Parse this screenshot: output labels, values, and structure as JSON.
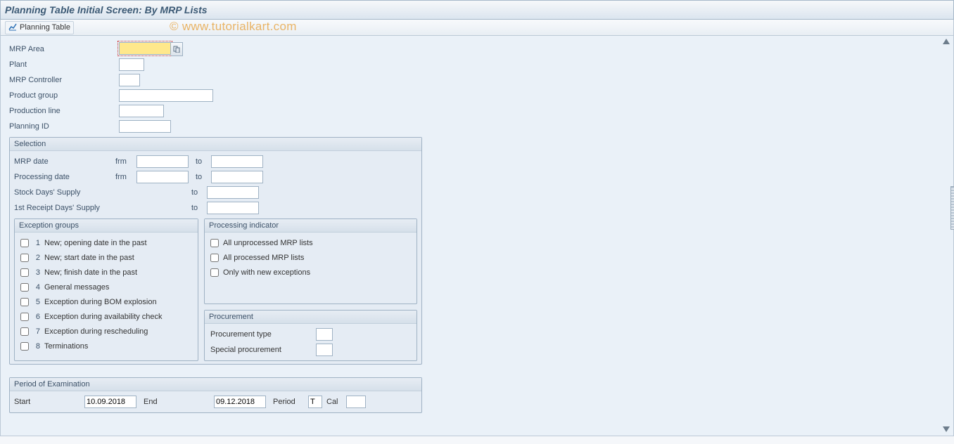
{
  "header": {
    "title": "Planning Table Initial Screen: By MRP Lists"
  },
  "toolbar": {
    "planning_table": "Planning Table"
  },
  "watermark": "© www.tutorialkart.com",
  "fields": {
    "mrp_area_lbl": "MRP Area",
    "plant_lbl": "Plant",
    "mrp_controller_lbl": "MRP Controller",
    "product_group_lbl": "Product group",
    "production_line_lbl": "Production line",
    "planning_id_lbl": "Planning ID"
  },
  "selection": {
    "title": "Selection",
    "mrp_date_lbl": "MRP date",
    "processing_date_lbl": "Processing date",
    "stock_supply_lbl": "Stock Days' Supply",
    "first_receipt_lbl": "1st Receipt Days' Supply",
    "frm": "frm",
    "to": "to"
  },
  "exception_groups": {
    "title": "Exception groups",
    "items": [
      {
        "num": "1",
        "label": "New; opening date in the past"
      },
      {
        "num": "2",
        "label": "New; start date in the past"
      },
      {
        "num": "3",
        "label": "New; finish date in the past"
      },
      {
        "num": "4",
        "label": "General messages"
      },
      {
        "num": "5",
        "label": "Exception during BOM explosion"
      },
      {
        "num": "6",
        "label": "Exception during availability check"
      },
      {
        "num": "7",
        "label": "Exception during rescheduling"
      },
      {
        "num": "8",
        "label": "Terminations"
      }
    ]
  },
  "processing_indicator": {
    "title": "Processing indicator",
    "items": [
      {
        "label": "All unprocessed MRP lists"
      },
      {
        "label": "All processed MRP lists"
      },
      {
        "label": "Only with new exceptions"
      }
    ]
  },
  "procurement": {
    "title": "Procurement",
    "type_lbl": "Procurement type",
    "special_lbl": "Special procurement"
  },
  "period_exam": {
    "title": "Period of Examination",
    "start_lbl": "Start",
    "start_val": "10.09.2018",
    "end_lbl": "End",
    "end_val": "09.12.2018",
    "period_lbl": "Period",
    "period_val": "T",
    "cal_lbl": "Cal"
  }
}
